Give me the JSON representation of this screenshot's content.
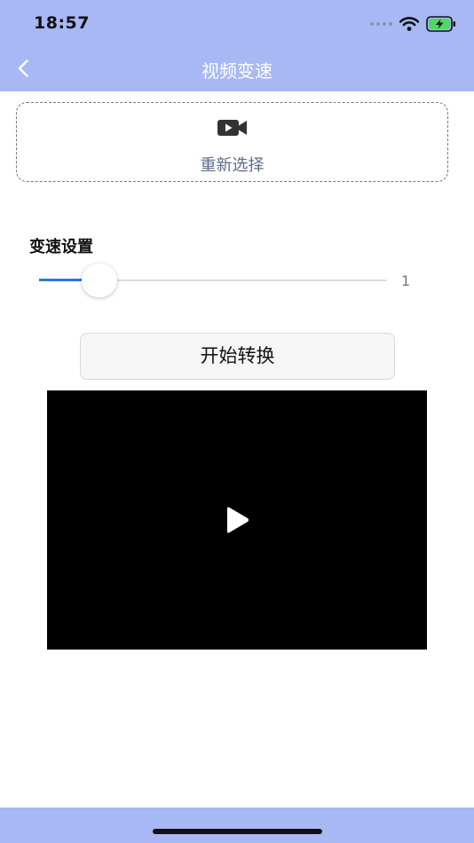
{
  "status_bar": {
    "time": "18:57",
    "icons": [
      "signal-dots-icon",
      "wifi-icon",
      "battery-charging-icon"
    ],
    "battery_color": "#4cd964"
  },
  "nav": {
    "title": "视频变速",
    "back_icon": "chevron-left-icon",
    "background": "#a8b8f4"
  },
  "picker": {
    "icon": "video-camera-icon",
    "label": "重新选择"
  },
  "speed": {
    "title": "变速设置",
    "value": 1,
    "value_label": "1",
    "min": 0,
    "max": 10,
    "accent": "#2b78d6"
  },
  "convert": {
    "label": "开始转换"
  },
  "video": {
    "icon": "play-icon"
  }
}
